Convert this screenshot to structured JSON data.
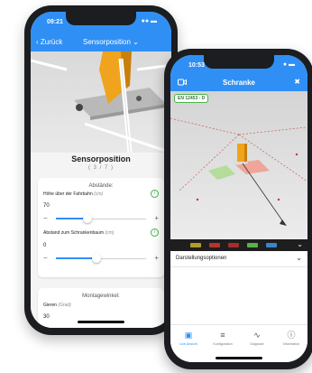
{
  "back_phone": {
    "status": {
      "time": "09:21",
      "icons": "●● ▬"
    },
    "nav": {
      "back_label": "‹ Zurück",
      "title": "Sensorposition ⌄"
    },
    "card": {
      "heading": "Sensorposition",
      "step": "( 3 / 7 )",
      "distances": {
        "title": "Abstände:",
        "height": {
          "label": "Höhe über der Fahrbahn",
          "unit": "(cm)",
          "value": "70",
          "slider_fraction": 0.35
        },
        "barrier_distance": {
          "label": "Abstand zum Schrankenbaum",
          "unit": "(cm)",
          "value": "0",
          "slider_fraction": 0.45
        }
      },
      "mounting": {
        "title": "Montagewinkel:",
        "yaw": {
          "label": "Gieren",
          "unit": "(Grad)",
          "value": "30"
        }
      }
    },
    "help_label": "i",
    "minus": "−",
    "plus": "+"
  },
  "front_phone": {
    "status": {
      "time": "10:53",
      "icons": "● ▬"
    },
    "nav": {
      "title": "Schranke",
      "camera_icon": "camera-icon",
      "bluetooth_icon": "bluetooth-off-icon",
      "bluetooth_glyph": "✖"
    },
    "badge": "EN 12453 - D",
    "legend_colors": [
      "#b59a2a",
      "#b8322e",
      "#a52d2d",
      "#55b34a",
      "#3b84c9"
    ],
    "options": {
      "label": "Darstellungsoptionen",
      "chevron": "⌄"
    },
    "tabs": [
      {
        "label": "Live-Ansicht",
        "icon": "car-icon",
        "glyph": "▣",
        "active": true
      },
      {
        "label": "Konfiguration",
        "icon": "sliders-icon",
        "glyph": "≡",
        "active": false
      },
      {
        "label": "Diagnose",
        "icon": "chart-icon",
        "glyph": "∿",
        "active": false
      },
      {
        "label": "Information",
        "icon": "info-icon",
        "glyph": "ⓘ",
        "active": false
      }
    ],
    "legend_chevron": "⌄"
  }
}
